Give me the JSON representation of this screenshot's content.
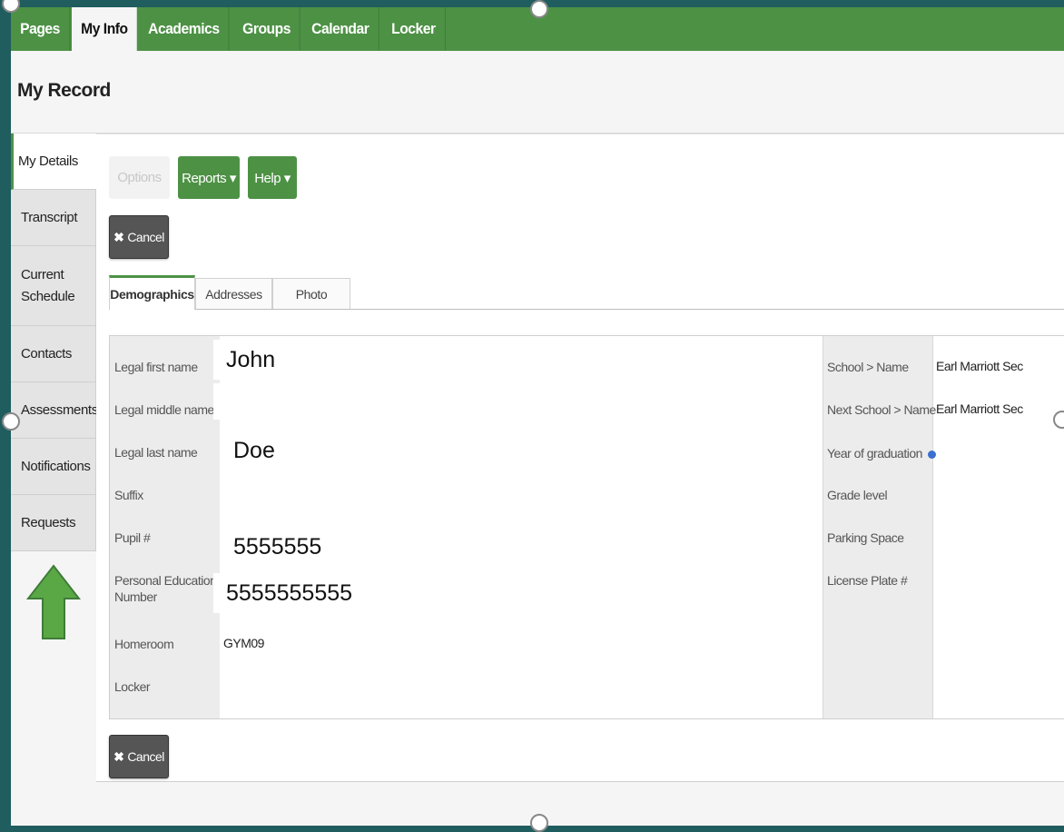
{
  "topnav": {
    "tabs": [
      {
        "label": "Pages",
        "active": false
      },
      {
        "label": "My Info",
        "active": true
      },
      {
        "label": "Academics",
        "active": false
      },
      {
        "label": "Groups",
        "active": false
      },
      {
        "label": "Calendar",
        "active": false
      },
      {
        "label": "Locker",
        "active": false
      }
    ]
  },
  "page_title": "My Record",
  "sidenav": {
    "items": [
      {
        "label": "My Details",
        "active": true
      },
      {
        "label": "Transcript",
        "active": false
      },
      {
        "label": "Current Schedule",
        "active": false
      },
      {
        "label": "Contacts",
        "active": false
      },
      {
        "label": "Assessments",
        "active": false
      },
      {
        "label": "Notifications",
        "active": false
      },
      {
        "label": "Requests",
        "active": false
      }
    ]
  },
  "toolbar": {
    "options_label": "Options",
    "reports_label": "Reports ▾",
    "help_label": "Help ▾",
    "cancel_label": "Cancel"
  },
  "subtabs": [
    {
      "label": "Demographics",
      "active": true
    },
    {
      "label": "Addresses",
      "active": false
    },
    {
      "label": "Photo",
      "active": false
    }
  ],
  "form": {
    "left": {
      "legal_first_name_label": "Legal first name",
      "legal_first_name": "John",
      "legal_middle_name_label": "Legal middle name",
      "legal_last_name_label": "Legal last name",
      "legal_last_name": "Doe",
      "suffix_label": "Suffix",
      "pupil_label": "Pupil #",
      "pupil": "5555555",
      "pen_label_line1": "Personal Education",
      "pen_label_line2": "Number",
      "pen": "5555555555",
      "homeroom_label": "Homeroom",
      "homeroom": "GYM09",
      "locker_label": "Locker"
    },
    "right": {
      "school_label": "School > Name",
      "school": "Earl Marriott Sec",
      "next_school_label": "Next School > Name",
      "next_school": "Earl Marriott Sec",
      "yog_label": "Year of graduation",
      "grade_label": "Grade level",
      "parking_label": "Parking Space",
      "plate_label": "License Plate #"
    }
  },
  "colors": {
    "accent": "#4d9145",
    "slide_bg": "#1f5d5e",
    "arrow": "#5aa845"
  }
}
